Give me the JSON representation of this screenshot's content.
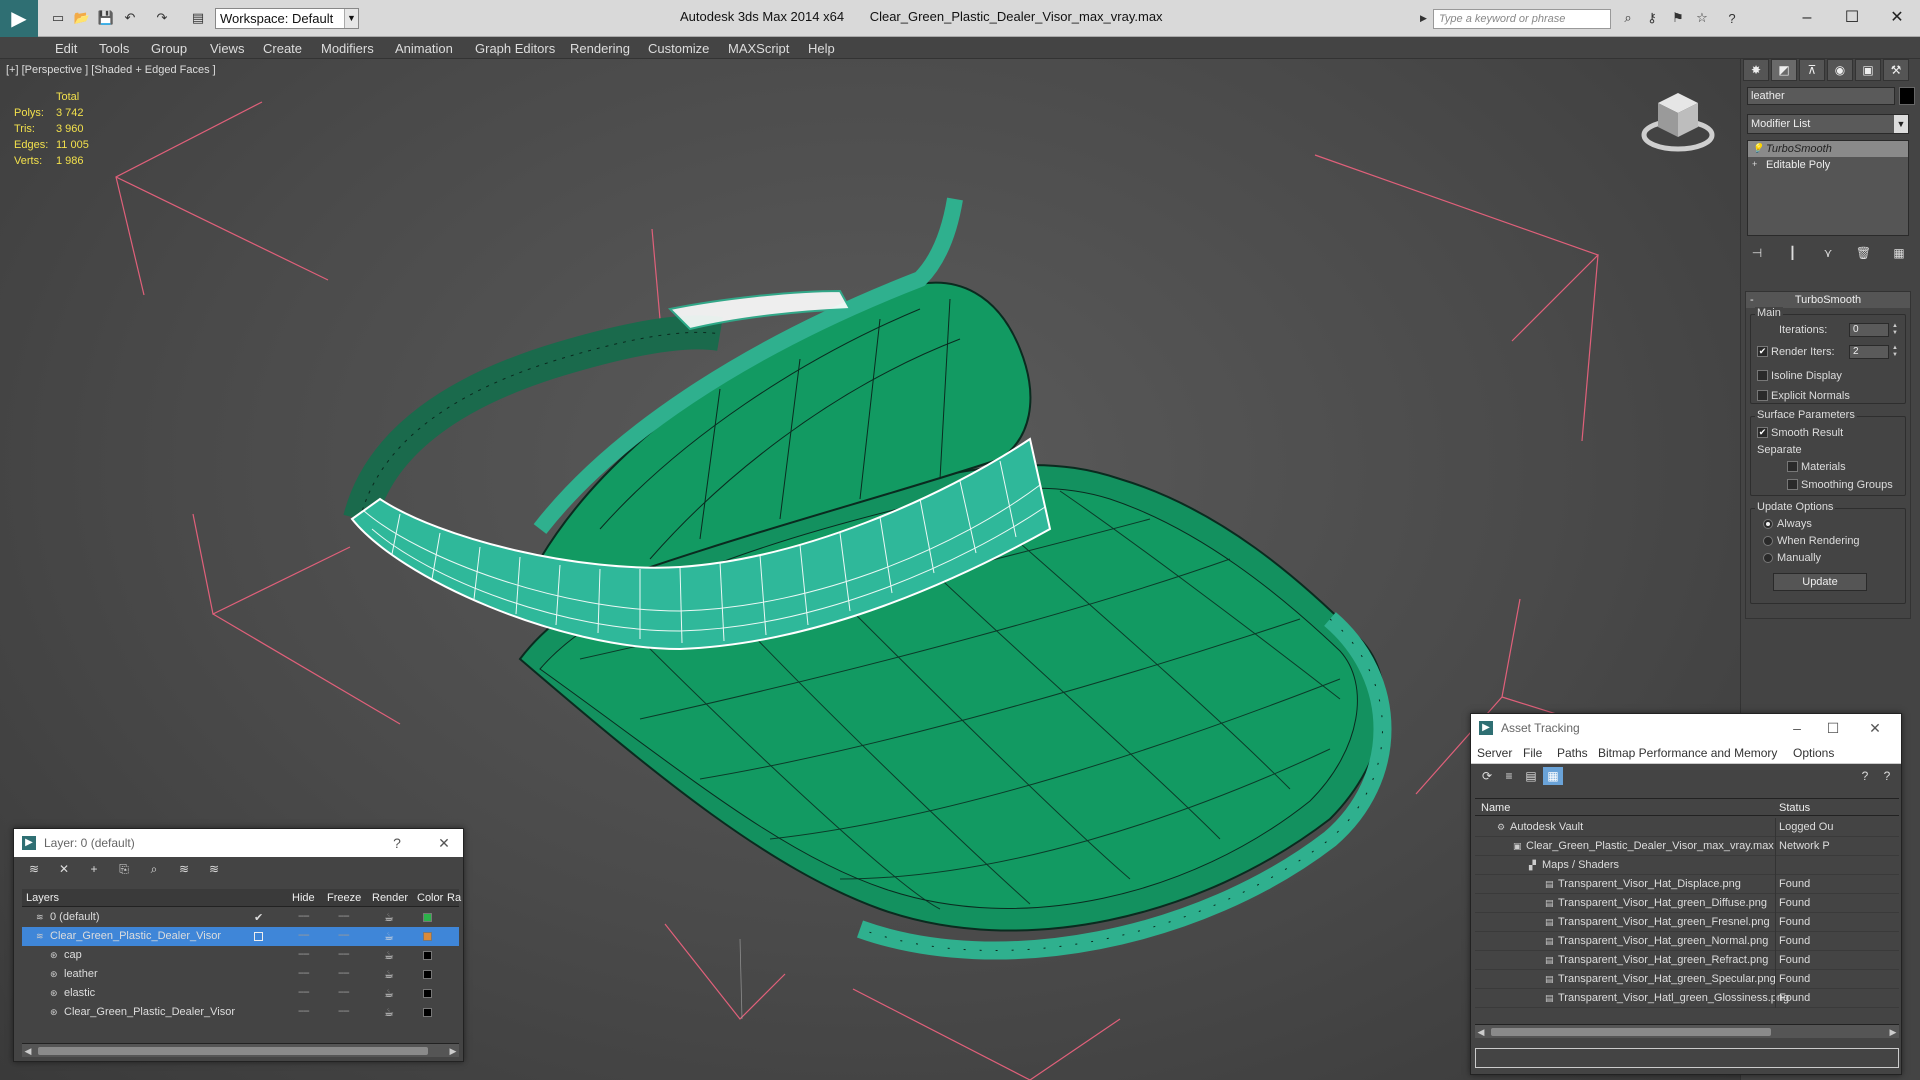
{
  "titlebar": {
    "workspace_label": "Workspace: Default",
    "app_title": "Autodesk 3ds Max  2014 x64",
    "file_title": "Clear_Green_Plastic_Dealer_Visor_max_vray.max",
    "search_placeholder": "Type a keyword or phrase"
  },
  "menu": [
    "Edit",
    "Tools",
    "Group",
    "Views",
    "Create",
    "Modifiers",
    "Animation",
    "Graph Editors",
    "Rendering",
    "Customize",
    "MAXScript",
    "Help"
  ],
  "viewport": {
    "label": "[+] [Perspective ] [Shaded + Edged Faces ]",
    "stats_header": "Total",
    "stats": [
      {
        "k": "Polys:",
        "v": "3 742"
      },
      {
        "k": "Tris:",
        "v": "3 960"
      },
      {
        "k": "Edges:",
        "v": "11 005"
      },
      {
        "k": "Verts:",
        "v": "1 986"
      }
    ],
    "model_color": "#16966a",
    "edge_color": "#0b2f22",
    "band_color": "#2fb89a"
  },
  "command_panel": {
    "object_name": "leather",
    "modifier_list": "Modifier List",
    "stack": [
      "TurboSmooth",
      "Editable Poly"
    ],
    "rollout_title": "TurboSmooth",
    "main_group": "Main",
    "iterations_label": "Iterations:",
    "iterations_value": "0",
    "render_iters_label": "Render Iters:",
    "render_iters_value": "2",
    "isoline_label": "Isoline Display",
    "explicit_normals_label": "Explicit Normals",
    "surface_group": "Surface Parameters",
    "smooth_result_label": "Smooth Result",
    "separate_label": "Separate",
    "materials_label": "Materials",
    "smoothing_groups_label": "Smoothing Groups",
    "update_group": "Update Options",
    "always_label": "Always",
    "when_rendering_label": "When Rendering",
    "manually_label": "Manually",
    "update_button": "Update"
  },
  "layer_window": {
    "title": "Layer: 0 (default)",
    "help": "?",
    "columns": [
      "Layers",
      "Hide",
      "Freeze",
      "Render",
      "Color",
      "Ra"
    ],
    "rows": [
      {
        "name": "0 (default)",
        "indent": 0,
        "color": "#2cb24a",
        "check": "✔",
        "selected": false
      },
      {
        "name": "Clear_Green_Plastic_Dealer_Visor",
        "indent": 0,
        "color": "#d98a3a",
        "check": "",
        "selected": true
      },
      {
        "name": "cap",
        "indent": 1,
        "color": "#000000",
        "check": "",
        "selected": false
      },
      {
        "name": "leather",
        "indent": 1,
        "color": "#000000",
        "check": "",
        "selected": false
      },
      {
        "name": "elastic",
        "indent": 1,
        "color": "#000000",
        "check": "",
        "selected": false
      },
      {
        "name": "Clear_Green_Plastic_Dealer_Visor",
        "indent": 1,
        "color": "#000000",
        "check": "",
        "selected": false
      }
    ]
  },
  "asset_tracking": {
    "title": "Asset Tracking",
    "menu": [
      "Server",
      "File",
      "Paths",
      "Bitmap Performance and Memory",
      "Options"
    ],
    "columns": [
      "Name",
      "Status"
    ],
    "rows": [
      {
        "name": "Autodesk Vault",
        "status": "Logged Ou",
        "indent": 1
      },
      {
        "name": "Clear_Green_Plastic_Dealer_Visor_max_vray.max",
        "status": "Network P",
        "indent": 2
      },
      {
        "name": "Maps / Shaders",
        "status": "",
        "indent": 3
      },
      {
        "name": "Transparent_Visor_Hat_Displace.png",
        "status": "Found",
        "indent": 4
      },
      {
        "name": "Transparent_Visor_Hat_green_Diffuse.png",
        "status": "Found",
        "indent": 4
      },
      {
        "name": "Transparent_Visor_Hat_green_Fresnel.png",
        "status": "Found",
        "indent": 4
      },
      {
        "name": "Transparent_Visor_Hat_green_Normal.png",
        "status": "Found",
        "indent": 4
      },
      {
        "name": "Transparent_Visor_Hat_green_Refract.png",
        "status": "Found",
        "indent": 4
      },
      {
        "name": "Transparent_Visor_Hat_green_Specular.png",
        "status": "Found",
        "indent": 4
      },
      {
        "name": "Transparent_Visor_Hatl_green_Glossiness.png",
        "status": "Found",
        "indent": 4
      }
    ]
  }
}
